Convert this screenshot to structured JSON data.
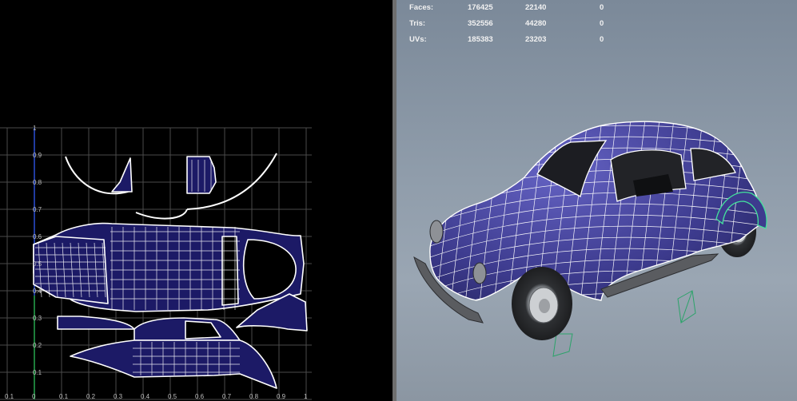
{
  "uv_editor": {
    "v_ticks": [
      "1",
      "0.9",
      "0.8",
      "0.7",
      "0.6",
      "0.5",
      "0.4",
      "0.3",
      "0.2",
      "0.1",
      "0"
    ],
    "u_ticks": [
      "0.1",
      "0",
      "0.1",
      "0.2",
      "0.3",
      "0.4",
      "0.5",
      "0.6",
      "0.7",
      "0.8",
      "0.9",
      "1"
    ]
  },
  "hud": {
    "rows": [
      {
        "label": "Faces:",
        "v1": "176425",
        "v2": "22140",
        "v3": "0"
      },
      {
        "label": "Tris:",
        "v1": "352556",
        "v2": "44280",
        "v3": "0"
      },
      {
        "label": "UVs:",
        "v1": "185383",
        "v2": "23203",
        "v3": "0"
      }
    ]
  },
  "colors": {
    "uv_fill": "#1c1a66",
    "uv_line": "#ffffff",
    "car_body": "#3d3b8e",
    "grid": "#4a4a4a",
    "axis_v": "#2a4fd6",
    "axis_u": "#1f9a2a",
    "selection": "#43e39c"
  }
}
